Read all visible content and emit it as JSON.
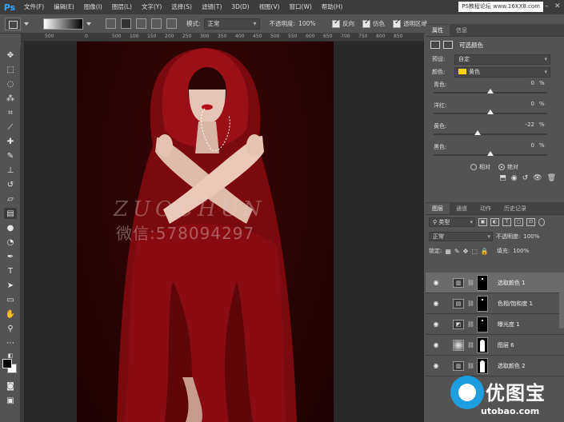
{
  "app": {
    "logo": "Ps",
    "site_badge": "PS教程论坛 www.16XX8.com"
  },
  "menu": [
    "文件(F)",
    "编辑(E)",
    "图像(I)",
    "图层(L)",
    "文字(Y)",
    "选择(S)",
    "滤镜(T)",
    "3D(D)",
    "视图(V)",
    "窗口(W)",
    "帮助(H)"
  ],
  "options": {
    "mode_label": "模式:",
    "mode_value": "正常",
    "opacity_label": "不透明度:",
    "opacity_value": "100%",
    "reverse_label": "反向",
    "dither_label": "仿色",
    "transparency_label": "透明区域"
  },
  "ruler_ticks": [
    "500",
    "0",
    "500",
    "100",
    "150",
    "200",
    "250",
    "300",
    "350",
    "400",
    "450",
    "500",
    "550",
    "600",
    "650",
    "700",
    "750",
    "800",
    "850"
  ],
  "canvas": {
    "watermark_latin": "ZUOCHUN",
    "watermark_cn": "微信:578094297"
  },
  "properties": {
    "tabs": [
      "属性",
      "信息"
    ],
    "title": "可选颜色",
    "preset_label": "预设:",
    "preset_value": "自定",
    "color_label": "颜色:",
    "color_value": "黄色",
    "color_swatch": "#ffd200",
    "sliders": [
      {
        "label": "青色:",
        "value": "0",
        "unit": "%",
        "position": 0.5
      },
      {
        "label": "洋红:",
        "value": "0",
        "unit": "%",
        "position": 0.5
      },
      {
        "label": "黄色:",
        "value": "-22",
        "unit": "%",
        "position": 0.39
      },
      {
        "label": "黑色:",
        "value": "0",
        "unit": "%",
        "position": 0.5
      }
    ],
    "relative_label": "相对",
    "absolute_label": "绝对"
  },
  "layers": {
    "tabs": [
      "图层",
      "通道",
      "动作",
      "历史记录"
    ],
    "filter_value": "类型",
    "blend_value": "正常",
    "opacity_label": "不透明度:",
    "opacity_value": "100%",
    "lock_label": "锁定:",
    "fill_label": "填充:",
    "fill_value": "100%",
    "rows": [
      {
        "name": "选取颜色 1",
        "icon": "selective-color-icon",
        "selected": true
      },
      {
        "name": "色相/饱和度 1",
        "icon": "hue-saturation-icon",
        "selected": false
      },
      {
        "name": "曝光度 1",
        "icon": "exposure-icon",
        "selected": false
      },
      {
        "name": "图层 6",
        "icon": "layer-thumbnail",
        "selected": false
      },
      {
        "name": "选取颜色 2",
        "icon": "selective-color-icon",
        "selected": false
      }
    ]
  },
  "brand_logo": {
    "cn": "优图宝",
    "en": "utobao.com",
    "color": "#1e9ee0"
  }
}
